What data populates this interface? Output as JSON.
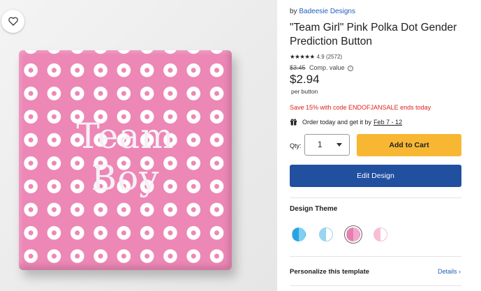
{
  "product_image": {
    "text_line1": "Team",
    "text_line2": "Boy",
    "button_color": "#ec87b6",
    "dot_color": "#ffffff"
  },
  "favorite": {
    "icon": "heart-outline-icon"
  },
  "seller": {
    "prefix": "by",
    "name": "Badeesie Designs"
  },
  "product": {
    "title": "\"Team Girl\" Pink Polka Dot Gender Prediction Button",
    "stars": "★★★★★",
    "rating": "4.9",
    "review_count": "(2572)",
    "comp_price": "$3.45",
    "comp_label": "Comp. value",
    "info_icon": "i",
    "price": "$2.94",
    "price_unit": "per button"
  },
  "promo": {
    "text": "Save 15% with code ENDOFJANSALE ends today",
    "color": "#e0201f"
  },
  "delivery": {
    "icon": "gift-icon",
    "text": "Order today and get it by",
    "date": "Feb 7 - 12"
  },
  "purchase": {
    "qty_label": "Qty:",
    "qty_value": "1",
    "add_to_cart": "Add to Cart",
    "add_to_cart_color": "#f7b733",
    "edit_design": "Edit Design",
    "edit_design_color": "#2150a0"
  },
  "design_theme": {
    "title": "Design Theme",
    "swatches": [
      {
        "left": "#2aa4e0",
        "right": "#7fd0f2",
        "selected": false
      },
      {
        "left": "#9ad4f0",
        "right": "#ffffff",
        "selected": false
      },
      {
        "left": "#e57fb0",
        "right": "#f2a8cc",
        "selected": true
      },
      {
        "left": "#f6bfd6",
        "right": "#ffffff",
        "selected": false
      }
    ]
  },
  "personalize": {
    "title": "Personalize this template",
    "details_link": "Details ›"
  }
}
